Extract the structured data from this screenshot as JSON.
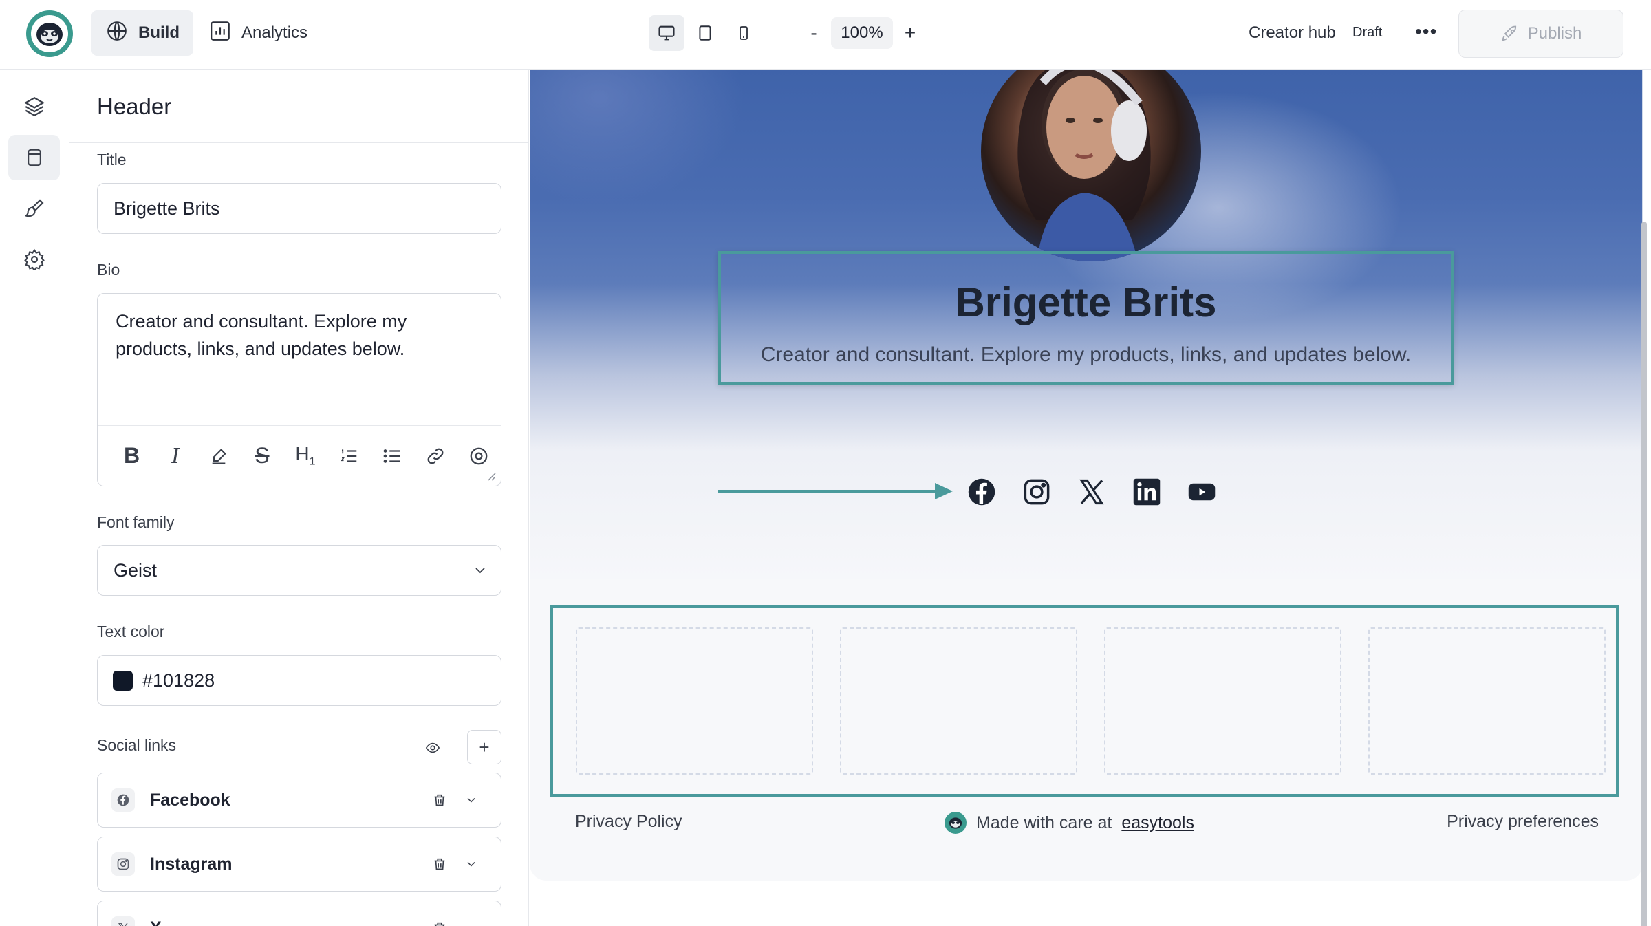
{
  "topbar": {
    "tabs": [
      {
        "label": "Build",
        "icon": "globe-icon",
        "active": true
      },
      {
        "label": "Analytics",
        "icon": "chart-icon",
        "active": false
      }
    ],
    "devices": [
      "desktop-icon",
      "tablet-icon",
      "mobile-icon"
    ],
    "zoom": {
      "minus": "-",
      "value": "100%",
      "plus": "+"
    },
    "project_name": "Creator hub",
    "status": "Draft",
    "more": "•••",
    "publish_label": "Publish"
  },
  "rail": [
    "layers-icon",
    "page-icon",
    "brush-icon",
    "gear-icon"
  ],
  "panel": {
    "title": "Header",
    "title_label": "Title",
    "title_value": "Brigette Brits",
    "bio_label": "Bio",
    "bio_value": "Creator and consultant. Explore my products, links, and updates below.",
    "toolbar": [
      "bold-icon",
      "italic-icon",
      "highlight-icon",
      "strikethrough-icon",
      "heading-icon",
      "ordered-list-icon",
      "bullet-list-icon",
      "link-icon",
      "emoji-icon"
    ],
    "font_label": "Font family",
    "font_value": "Geist",
    "color_label": "Text color",
    "color_value": "#101828",
    "social_label": "Social links",
    "social_links": [
      {
        "name": "Facebook",
        "icon": "facebook-icon"
      },
      {
        "name": "Instagram",
        "icon": "instagram-icon"
      },
      {
        "name": "X",
        "icon": "x-icon"
      }
    ]
  },
  "preview": {
    "name": "Brigette Brits",
    "bio": "Creator and consultant. Explore my products, links, and updates below.",
    "social_icons": [
      "facebook-icon",
      "instagram-icon",
      "x-icon",
      "linkedin-icon",
      "youtube-icon"
    ],
    "footer": {
      "left": "Privacy Policy",
      "center_prefix": "Made with care at",
      "center_link": "easytools",
      "right": "Privacy preferences"
    }
  }
}
